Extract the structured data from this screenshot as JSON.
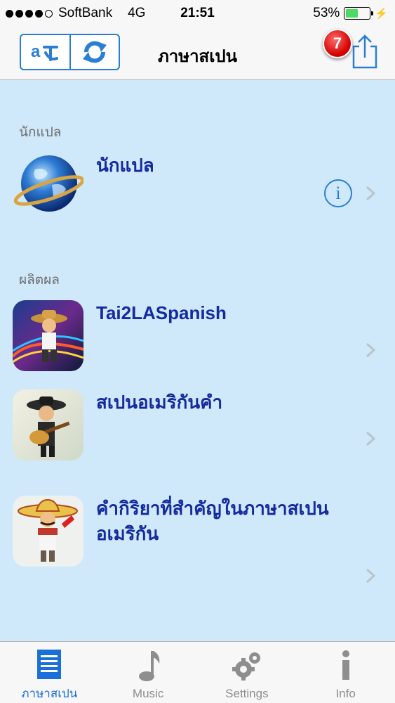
{
  "status_bar": {
    "carrier": "SoftBank",
    "network": "4G",
    "time": "21:51",
    "battery_percent": "53%",
    "battery_level": 0.53
  },
  "nav": {
    "title": "ภาษาสเปน",
    "badge_count": "7",
    "left_segment_icons": [
      "translate-icon",
      "refresh-icon"
    ],
    "right_icon": "share-icon"
  },
  "sections": [
    {
      "header": "นักแปล",
      "rows": [
        {
          "title": "นักแปล",
          "icon": "globe-icon",
          "has_info": true
        }
      ]
    },
    {
      "header": "ผลิตผล",
      "rows": [
        {
          "title": "Tai2LASpanish",
          "icon": "app-tai2laspanish-icon"
        },
        {
          "title": "สเปนอเมริกันคำ",
          "icon": "app-guitar-player-icon"
        },
        {
          "title": "คำกิริยาที่สำคัญในภาษาสเปน อเมริกัน",
          "icon": "app-sombrero-man-icon"
        }
      ]
    }
  ],
  "tabs": [
    {
      "label": "ภาษาสเปน",
      "icon": "document-list-icon",
      "active": true
    },
    {
      "label": "Music",
      "icon": "music-note-icon",
      "active": false
    },
    {
      "label": "Settings",
      "icon": "gears-icon",
      "active": false
    },
    {
      "label": "Info",
      "icon": "info-icon",
      "active": false
    }
  ],
  "colors": {
    "accent": "#1a6fd8",
    "title_text": "#142a9e",
    "content_bg": "#cfe9fa",
    "badge": "#d40000"
  }
}
